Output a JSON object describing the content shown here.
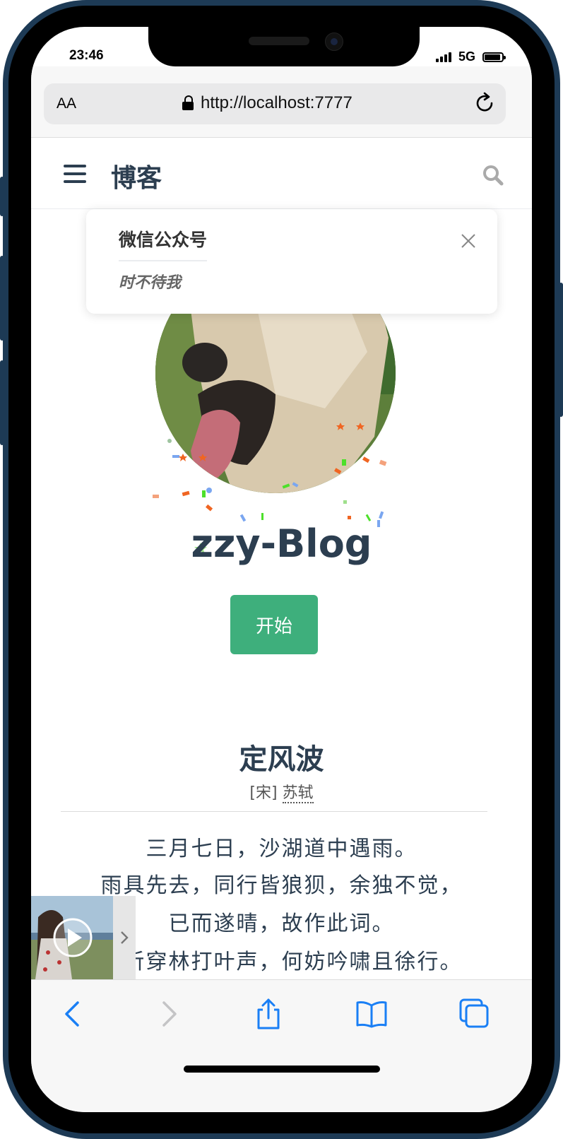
{
  "status_bar": {
    "time": "23:46",
    "network": "5G"
  },
  "browser": {
    "text_size_label": "AA",
    "url": "http://localhost:7777"
  },
  "navbar": {
    "site_title": "博客"
  },
  "popup": {
    "title": "微信公众号",
    "text": "时不待我"
  },
  "hero": {
    "title": "zzy-Blog",
    "start_button": "开始"
  },
  "poem": {
    "title": "定风波",
    "dynasty": "[宋]",
    "author": "苏轼",
    "lines": [
      "三月七日，沙湖道中遇雨。",
      "雨具先去，同行皆狼狈，余独不觉，",
      "已而遂晴，故作此词。",
      "莫听穿林打叶声，何妨吟啸且徐行。"
    ]
  },
  "colors": {
    "accent": "#3eaf7c",
    "text": "#2c3e50",
    "link": "#1a7ff5"
  }
}
